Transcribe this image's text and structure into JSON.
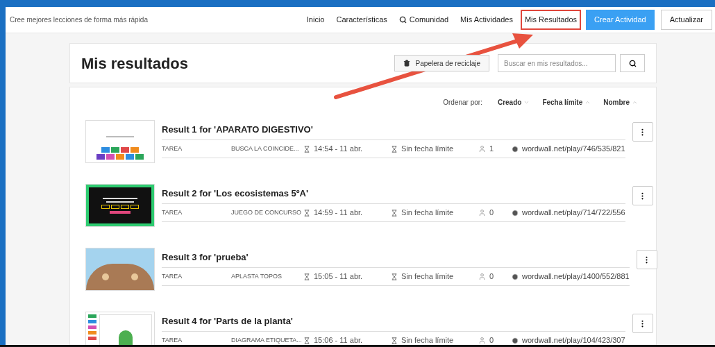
{
  "tagline": "Cree mejores lecciones de forma más rápida",
  "nav": [
    {
      "label": "Inicio",
      "kind": "link",
      "selected": false
    },
    {
      "label": "Características",
      "kind": "link",
      "selected": false
    },
    {
      "label": "Comunidad",
      "kind": "search-link",
      "selected": false
    },
    {
      "label": "Mis Actividades",
      "kind": "link",
      "selected": false
    },
    {
      "label": "Mis Resultados",
      "kind": "link",
      "selected": true
    },
    {
      "label": "Crear Actividad",
      "kind": "primary",
      "selected": false
    },
    {
      "label": "Actualizar",
      "kind": "outline",
      "selected": false
    }
  ],
  "page_title": "Mis resultados",
  "recycle_button": "Papelera de reciclaje",
  "search": {
    "placeholder": "Buscar en mis resultados..."
  },
  "sort": {
    "label": "Ordenar por:",
    "options": [
      {
        "label": "Creado",
        "kind": "down"
      },
      {
        "label": "Fecha límite",
        "kind": "up"
      },
      {
        "label": "Nombre",
        "kind": "up"
      }
    ]
  },
  "results": [
    {
      "title": "Result 1 for 'APARATO DIGESTIVO'",
      "type": "TAREA",
      "template": "BUSCA LA COINCIDE...",
      "created": "14:54 - 11 abr.",
      "deadline": "Sin fecha límite",
      "count": "1",
      "url": "wordwall.net/play/746/535/821",
      "kind": "tiles"
    },
    {
      "title": "Result 2 for 'Los ecosistemas 5ºA'",
      "type": "TAREA",
      "template": "JUEGO DE CONCURSO",
      "created": "14:59 - 11 abr.",
      "deadline": "Sin fecha límite",
      "count": "0",
      "url": "wordwall.net/play/714/722/556",
      "kind": "quiz"
    },
    {
      "title": "Result 3 for 'prueba'",
      "type": "TAREA",
      "template": "APLASTA TOPOS",
      "created": "15:05 - 11 abr.",
      "deadline": "Sin fecha límite",
      "count": "0",
      "url": "wordwall.net/play/1400/552/881",
      "kind": "moles"
    },
    {
      "title": "Result 4 for 'Parts de la planta'",
      "type": "TAREA",
      "template": "DIAGRAMA ETIQUETA...",
      "created": "15:06 - 11 abr.",
      "deadline": "Sin fecha límite",
      "count": "0",
      "url": "wordwall.net/play/104/423/307",
      "kind": "diagram"
    }
  ]
}
